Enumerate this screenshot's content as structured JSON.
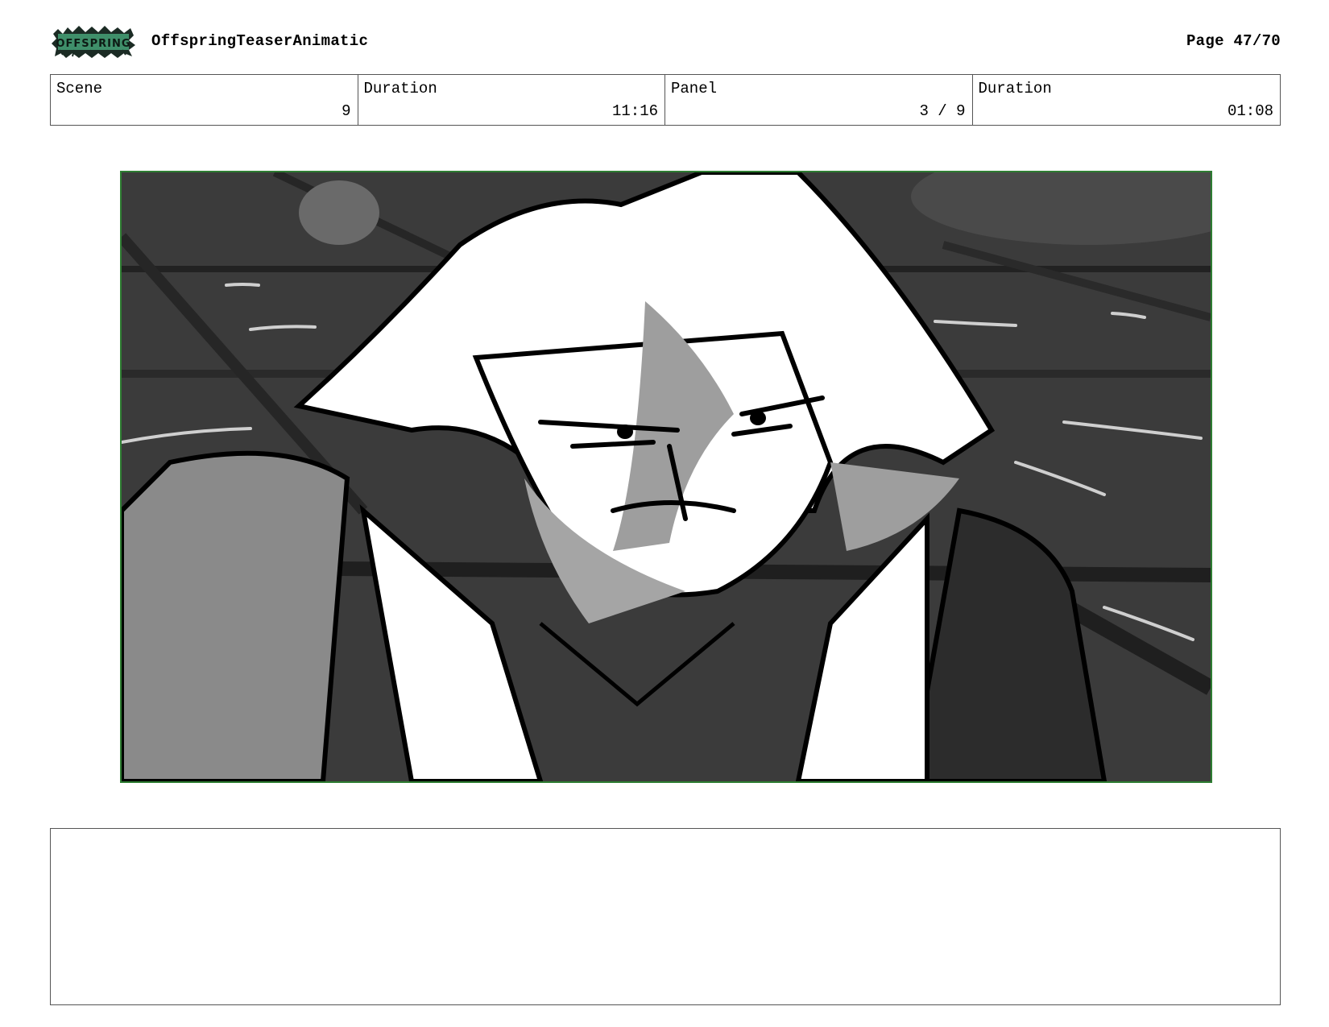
{
  "header": {
    "logo_text": "OFFSPRING",
    "project_title": "OffspringTeaserAnimatic",
    "page_label": "Page 47/70"
  },
  "info": {
    "scene_label": "Scene",
    "scene_value": "9",
    "scene_duration_label": "Duration",
    "scene_duration_value": "11:16",
    "panel_label": "Panel",
    "panel_value": "3 / 9",
    "panel_duration_label": "Duration",
    "panel_duration_value": "01:08"
  },
  "panel_image": {
    "description_icon": "storyboard-sketch",
    "frame_color": "#2e7d32"
  },
  "notes": {
    "text": ""
  }
}
